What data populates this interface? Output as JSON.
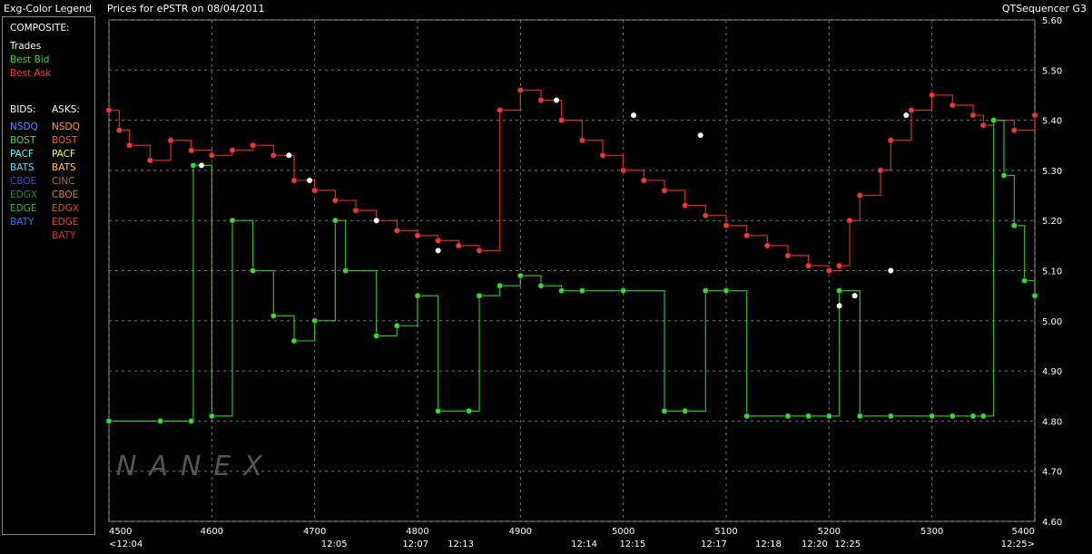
{
  "header": {
    "legend_title": "Exg-Color Legend",
    "chart_title": "Prices for  ePSTR  on  08/04/2011",
    "app_name": "QTSequencer G3"
  },
  "legend": {
    "composite_label": "COMPOSITE:",
    "trades": {
      "label": "Trades",
      "color": "#ffffff"
    },
    "best_bid": {
      "label": "Best Bid",
      "color": "#33dd33"
    },
    "best_ask": {
      "label": "Best Ask",
      "color": "#ff3333"
    },
    "bids_label": "BIDS:",
    "asks_label": "ASKS:",
    "bids": [
      {
        "label": "NSDQ",
        "color": "#5b8cff"
      },
      {
        "label": "BOST",
        "color": "#66cc66"
      },
      {
        "label": "PACF",
        "color": "#55ffff"
      },
      {
        "label": "BATS",
        "color": "#66ddff"
      },
      {
        "label": "CBOE",
        "color": "#3355cc"
      },
      {
        "label": "EDGX",
        "color": "#338833"
      },
      {
        "label": "EDGE",
        "color": "#44aa44"
      },
      {
        "label": "BATY",
        "color": "#4477dd"
      }
    ],
    "asks": [
      {
        "label": "NSDQ",
        "color": "#ff9933"
      },
      {
        "label": "BOST",
        "color": "#dd6633"
      },
      {
        "label": "PACF",
        "color": "#ffff44"
      },
      {
        "label": "BATS",
        "color": "#ffcc33"
      },
      {
        "label": "CINC",
        "color": "#aa7744"
      },
      {
        "label": "CBOE",
        "color": "#cc8833"
      },
      {
        "label": "EDGX",
        "color": "#cc5522"
      },
      {
        "label": "EDGE",
        "color": "#dd4444"
      },
      {
        "label": "BATY",
        "color": "#cc3322"
      }
    ]
  },
  "watermark": "NANEX",
  "chart_data": {
    "type": "line",
    "xlim": [
      4500,
      5400
    ],
    "ylim": [
      4.6,
      5.6
    ],
    "x_ticks": [
      4500,
      4600,
      4700,
      4800,
      4900,
      5000,
      5100,
      5200,
      5300,
      5400
    ],
    "y_ticks": [
      "5.60",
      "5.50",
      "5.40",
      "5.30",
      "5.20",
      "5.10",
      "5.00",
      "4.90",
      "4.80",
      "4.70",
      "4.60"
    ],
    "y_tick_values": [
      5.6,
      5.5,
      5.4,
      5.3,
      5.2,
      5.1,
      5.0,
      4.9,
      4.8,
      4.7,
      4.6
    ],
    "time_labels": [
      {
        "x": 4500,
        "label": "<12:04"
      },
      {
        "x": 4719,
        "label": "12:05"
      },
      {
        "x": 4798,
        "label": "12:07"
      },
      {
        "x": 4842,
        "label": "12:13"
      },
      {
        "x": 4962,
        "label": "12:14"
      },
      {
        "x": 5009,
        "label": "12:15"
      },
      {
        "x": 5088,
        "label": "12:17"
      },
      {
        "x": 5141,
        "label": "12:18"
      },
      {
        "x": 5186,
        "label": "12:20"
      },
      {
        "x": 5218,
        "label": "12:25"
      },
      {
        "x": 5400,
        "label": "12:25>"
      }
    ],
    "grid": true,
    "series": [
      {
        "name": "Best Ask",
        "color": "#ff3333",
        "x": [
          4500,
          4510,
          4520,
          4540,
          4560,
          4580,
          4600,
          4620,
          4640,
          4660,
          4680,
          4700,
          4720,
          4740,
          4760,
          4780,
          4800,
          4820,
          4840,
          4860,
          4880,
          4900,
          4920,
          4940,
          4960,
          4980,
          5000,
          5020,
          5040,
          5060,
          5080,
          5100,
          5120,
          5140,
          5160,
          5180,
          5200,
          5210,
          5220,
          5230,
          5250,
          5260,
          5280,
          5300,
          5320,
          5340,
          5350,
          5360,
          5380,
          5400
        ],
        "y": [
          5.42,
          5.38,
          5.35,
          5.32,
          5.36,
          5.34,
          5.33,
          5.34,
          5.35,
          5.33,
          5.28,
          5.26,
          5.24,
          5.22,
          5.2,
          5.18,
          5.17,
          5.16,
          5.15,
          5.14,
          5.42,
          5.46,
          5.44,
          5.4,
          5.36,
          5.33,
          5.3,
          5.28,
          5.26,
          5.23,
          5.21,
          5.19,
          5.17,
          5.15,
          5.13,
          5.11,
          5.1,
          5.11,
          5.2,
          5.25,
          5.3,
          5.36,
          5.42,
          5.45,
          5.43,
          5.41,
          5.39,
          5.4,
          5.38,
          5.41
        ]
      },
      {
        "name": "Best Bid",
        "color": "#33dd33",
        "x": [
          4500,
          4550,
          4580,
          4582,
          4600,
          4620,
          4640,
          4660,
          4680,
          4700,
          4720,
          4730,
          4760,
          4780,
          4800,
          4820,
          4850,
          4860,
          4880,
          4900,
          4920,
          4940,
          4960,
          5000,
          5040,
          5060,
          5080,
          5100,
          5120,
          5160,
          5180,
          5200,
          5210,
          5230,
          5260,
          5300,
          5320,
          5340,
          5350,
          5360,
          5370,
          5380,
          5390,
          5400
        ],
        "y": [
          4.8,
          4.8,
          4.8,
          5.31,
          4.81,
          5.2,
          5.1,
          5.01,
          4.96,
          5.0,
          5.2,
          5.1,
          4.97,
          4.99,
          5.05,
          4.82,
          4.82,
          5.05,
          5.07,
          5.09,
          5.07,
          5.06,
          5.06,
          5.06,
          4.82,
          4.82,
          5.06,
          5.06,
          4.81,
          4.81,
          4.81,
          4.81,
          5.06,
          4.81,
          4.81,
          4.81,
          4.81,
          4.81,
          4.81,
          5.4,
          5.29,
          5.19,
          5.08,
          5.05
        ]
      },
      {
        "name": "Trades",
        "color": "#ffffff",
        "x": [
          4590,
          4675,
          4695,
          4760,
          4820,
          4935,
          5010,
          5075,
          5210,
          5225,
          5260,
          5275
        ],
        "y": [
          5.31,
          5.33,
          5.28,
          5.2,
          5.14,
          5.44,
          5.41,
          5.37,
          5.03,
          5.05,
          5.1,
          5.41
        ]
      }
    ]
  }
}
